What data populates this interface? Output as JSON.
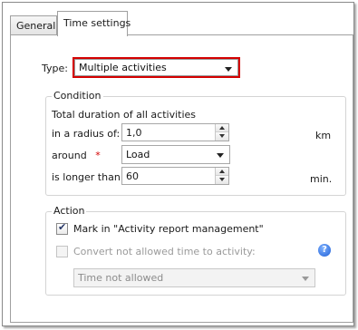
{
  "tabs": [
    {
      "label": "General",
      "active": false
    },
    {
      "label": "Time settings",
      "active": true
    }
  ],
  "type": {
    "label": "Type:",
    "selected": "Multiple activities"
  },
  "condition": {
    "legend": "Condition",
    "description": "Total duration of all activities",
    "radius_label": "in a radius of:",
    "radius_value": "1,0",
    "radius_unit": "km",
    "around_label": "around",
    "required_mark": "*",
    "around_selected": "Load",
    "longer_label": "is longer than:",
    "longer_value": "60",
    "longer_unit": "min."
  },
  "action": {
    "legend": "Action",
    "mark_label": "Mark in \"Activity report management\"",
    "mark_checked": true,
    "convert_label": "Convert not allowed time to activity:",
    "convert_checked": false,
    "convert_enabled": false,
    "activity_selected": "Time not allowed"
  },
  "colors": {
    "highlight_border": "#d40000",
    "required": "#d40000",
    "help_icon": "#1e5fd6"
  }
}
